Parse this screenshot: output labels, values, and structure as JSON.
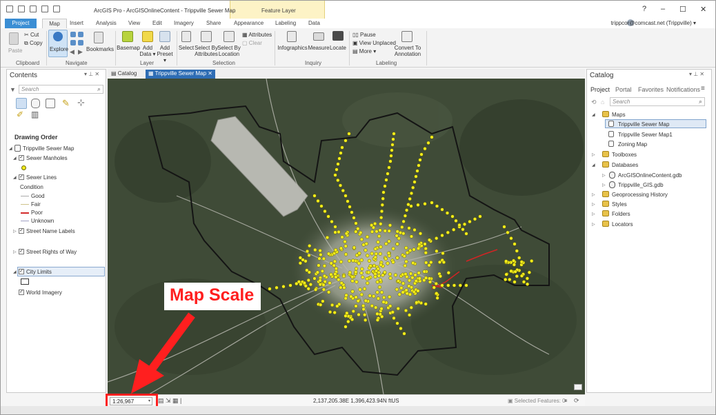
{
  "title": {
    "app": "ArcGIS Pro - ArcGISOnlineContent - Trippville Sewer Map",
    "context_tab": "Feature Layer",
    "win_help": "?",
    "win_min": "–",
    "win_max": "☐",
    "win_close": "✕"
  },
  "tabs": [
    "Project",
    "Map",
    "Insert",
    "Analysis",
    "View",
    "Edit",
    "Imagery",
    "Share",
    "Appearance",
    "Labeling",
    "Data"
  ],
  "user": "trippcor@comcast.net (Trippville) ▾",
  "ribbon": {
    "clipboard": {
      "group": "Clipboard",
      "paste": "Paste",
      "cut": "Cut",
      "copy": "Copy"
    },
    "navigate": {
      "group": "Navigate",
      "explore": "Explore",
      "bookmarks": "Bookmarks"
    },
    "layer": {
      "group": "Layer",
      "basemap": "Basemap",
      "add_data": "Add\nData ▾",
      "add_preset": "Add\nPreset ▾"
    },
    "selection": {
      "group": "Selection",
      "select": "Select",
      "by_attributes": "Select By\nAttributes",
      "by_location": "Select By\nLocation",
      "attributes": "Attributes",
      "clear": "Clear"
    },
    "inquiry": {
      "group": "Inquiry",
      "infographics": "Infographics",
      "measure": "Measure",
      "locate": "Locate"
    },
    "labeling": {
      "group": "Labeling",
      "pause": "Pause",
      "view_unplaced": "View Unplaced",
      "more": "More ▾",
      "convert": "Convert To\nAnnotation"
    }
  },
  "contents": {
    "title": "Contents",
    "search_placeholder": "Search",
    "drawing_order": "Drawing Order",
    "map": "Trippville Sewer Map",
    "sewer_manholes": "Sewer Manholes",
    "sewer_lines": "Sewer Lines",
    "condition": "Condition",
    "conditions": [
      "Good",
      "Fair",
      "Poor",
      "Unknown"
    ],
    "condition_colors": [
      "#a9a9a9",
      "#cfc28a",
      "#d32a2a",
      "#9f9fc4"
    ],
    "street_labels": "Street Name Labels",
    "street_row": "Street Rights of Way",
    "city_limits": "City Limits",
    "world_imagery": "World Imagery"
  },
  "map_tabs": {
    "catalog": "Catalog",
    "map": "Trippville Sewer Map"
  },
  "annotation": {
    "label": "Map Scale",
    "color": "#ff1f1f"
  },
  "map_status": {
    "scale": "1:26,967",
    "coords": "2,137,205.38E 1,396,423.94N ftUS",
    "selected": "Selected Features: 0"
  },
  "catalog": {
    "title": "Catalog",
    "tabs": [
      "Project",
      "Portal",
      "Favorites",
      "Notifications"
    ],
    "search_placeholder": "Search",
    "maps": "Maps",
    "map_items": [
      "Trippville Sewer Map",
      "Trippville Sewer Map1",
      "Zoning Map"
    ],
    "toolboxes": "Toolboxes",
    "databases": "Databases",
    "db_items": [
      "ArcGISOnlineContent.gdb",
      "Trippville_GIS.gdb"
    ],
    "geoprocessing": "Geoprocessing History",
    "styles": "Styles",
    "folders": "Folders",
    "locators": "Locators"
  }
}
